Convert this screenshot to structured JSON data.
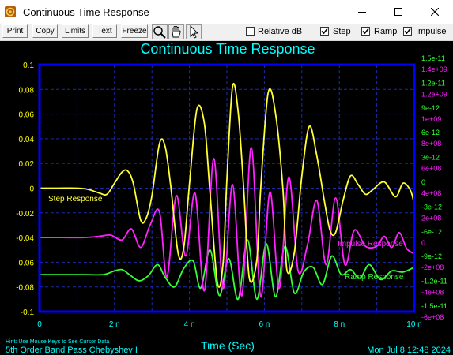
{
  "window": {
    "title": "Continuous Time Response"
  },
  "toolbar": {
    "buttons": [
      "Print",
      "Copy",
      "Limits",
      "Text",
      "Freeze"
    ],
    "tools": [
      "zoom-icon",
      "hand-pan-icon",
      "cursor-arrow-icon"
    ],
    "checkboxes": [
      {
        "label": "Relative dB",
        "checked": false
      },
      {
        "label": "Step",
        "checked": true
      },
      {
        "label": "Ramp",
        "checked": true
      },
      {
        "label": "Impulse",
        "checked": true
      }
    ]
  },
  "colors": {
    "background": "#000000",
    "frame": "#0000ff",
    "grid": "#1c2ba8",
    "title": "#00ffff",
    "step": "#ffff33",
    "impulse": "#ff22ff",
    "ramp": "#33ff33",
    "left_axis": "#ffff00",
    "x_axis": "#00ffff",
    "hint": "#00ffff"
  },
  "chart_data": {
    "type": "line",
    "title": "Continuous Time Response",
    "xlabel": "Time (Sec)",
    "x_ticks": [
      "0",
      "2 n",
      "4 n",
      "6 n",
      "8 n",
      "10 n"
    ],
    "xlim": [
      0,
      10
    ],
    "x_units": "ns",
    "grid": true,
    "axes": {
      "left": {
        "ticks": [
          "0.1",
          "0.08",
          "0.06",
          "0.04",
          "0.02",
          "0",
          "-0.02",
          "-0.04",
          "-0.06",
          "-0.08",
          "-0.1"
        ],
        "ylim": [
          -0.1,
          0.1
        ]
      },
      "right_ramp": {
        "ticks": [
          "1.5e-11",
          "1.2e-11",
          "9e-12",
          "6e-12",
          "3e-12",
          "0",
          "-3e-12",
          "-6e-12",
          "-9e-12",
          "-1.2e-11",
          "-1.5e-11"
        ],
        "ylim": [
          -1.65e-11,
          1.65e-11
        ]
      },
      "right_impulse": {
        "ticks": [
          "1.4e+09",
          "1.2e+09",
          "1e+09",
          "8e+08",
          "6e+08",
          "4e+08",
          "2e+08",
          "0",
          "-2e+08",
          "-4e+08",
          "-6e+08"
        ],
        "ylim": [
          -600000000.0,
          1450000000.0
        ]
      }
    },
    "series": [
      {
        "name": "Step Response",
        "color_key": "step",
        "axis": "left",
        "x": [
          0,
          0.5,
          1.0,
          1.3,
          1.6,
          1.8,
          2.0,
          2.2,
          2.35,
          2.5,
          2.7,
          2.85,
          3.0,
          3.2,
          3.35,
          3.5,
          3.7,
          3.85,
          4.0,
          4.2,
          4.4,
          4.55,
          4.75,
          4.9,
          5.0,
          5.15,
          5.3,
          5.45,
          5.6,
          5.8,
          5.9,
          6.1,
          6.3,
          6.5,
          6.6,
          6.8,
          7.0,
          7.2,
          7.4,
          7.6,
          7.75,
          7.9,
          8.1,
          8.3,
          8.5,
          8.7,
          8.9,
          9.2,
          9.5,
          9.7,
          9.9,
          10.0
        ],
        "y": [
          0,
          0,
          0,
          -0.001,
          -0.004,
          -0.005,
          0.004,
          0.013,
          0.014,
          0.004,
          -0.026,
          -0.024,
          -0.006,
          0.036,
          0.034,
          0.002,
          -0.053,
          -0.048,
          0.003,
          0.064,
          0.052,
          -0.004,
          -0.077,
          -0.06,
          0.007,
          0.082,
          0.062,
          -0.001,
          -0.073,
          -0.058,
          -0.001,
          0.077,
          0.06,
          -0.003,
          -0.066,
          -0.052,
          0.01,
          0.05,
          0.026,
          -0.01,
          -0.034,
          -0.036,
          -0.01,
          0.01,
          0.003,
          -0.005,
          -0.001,
          0.005,
          -0.007,
          0.004,
          -0.002,
          -0.013
        ]
      },
      {
        "name": "Impulse Response",
        "color_key": "impulse",
        "axis": "left",
        "x": [
          0,
          0.6,
          1.2,
          1.6,
          1.9,
          2.2,
          2.45,
          2.7,
          2.95,
          3.2,
          3.4,
          3.65,
          3.9,
          4.15,
          4.4,
          4.65,
          4.9,
          5.15,
          5.4,
          5.65,
          5.9,
          6.15,
          6.4,
          6.65,
          6.9,
          7.15,
          7.4,
          7.65,
          7.9,
          8.15,
          8.4,
          8.7,
          9.0,
          9.2,
          9.4,
          9.6,
          9.8,
          10.0
        ],
        "y": [
          -0.04,
          -0.04,
          -0.04,
          -0.039,
          -0.038,
          -0.042,
          -0.033,
          -0.048,
          -0.03,
          -0.019,
          -0.072,
          -0.006,
          -0.055,
          -0.004,
          -0.083,
          0.024,
          -0.081,
          0.003,
          -0.087,
          0.033,
          -0.088,
          -0.003,
          -0.081,
          0.009,
          -0.067,
          -0.046,
          -0.01,
          -0.062,
          -0.008,
          -0.062,
          -0.034,
          -0.047,
          -0.047,
          -0.039,
          -0.048,
          -0.036,
          -0.049,
          -0.053
        ]
      },
      {
        "name": "Ramp Response",
        "color_key": "ramp",
        "axis": "left",
        "x": [
          0,
          0.6,
          1.2,
          1.7,
          2.0,
          2.2,
          2.4,
          2.65,
          2.9,
          3.15,
          3.35,
          3.6,
          3.85,
          4.1,
          4.3,
          4.55,
          4.8,
          5.05,
          5.3,
          5.55,
          5.8,
          6.05,
          6.3,
          6.55,
          6.8,
          7.05,
          7.3,
          7.55,
          7.8,
          8.05,
          8.3,
          8.55,
          8.8,
          9.1,
          9.4,
          9.7,
          10.0
        ],
        "y": [
          -0.07,
          -0.07,
          -0.07,
          -0.07,
          -0.067,
          -0.066,
          -0.07,
          -0.075,
          -0.071,
          -0.062,
          -0.072,
          -0.08,
          -0.065,
          -0.059,
          -0.081,
          -0.05,
          -0.087,
          -0.057,
          -0.09,
          -0.042,
          -0.09,
          -0.045,
          -0.088,
          -0.047,
          -0.085,
          -0.068,
          -0.064,
          -0.078,
          -0.055,
          -0.07,
          -0.066,
          -0.073,
          -0.062,
          -0.074,
          -0.067,
          -0.068,
          -0.064
        ]
      }
    ],
    "annotations": [
      "Step Response",
      "Impulse Response",
      "Ramp Response"
    ]
  },
  "footer": {
    "hint": "Hint: Use Mouse Keys to See Cursor Data",
    "filter": "5th Order Band Pass Chebyshev I",
    "timestamp": "Mon Jul  8 12:48 2024"
  }
}
